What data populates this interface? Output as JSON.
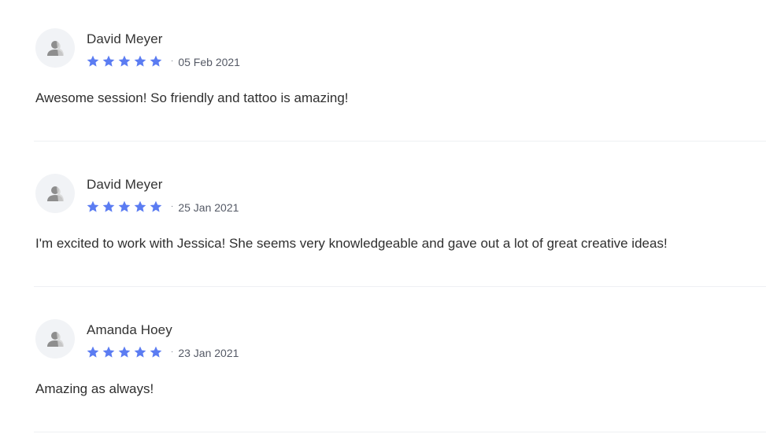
{
  "colors": {
    "star": "#5b7cf2",
    "avatar_bg": "#f1f3f6",
    "divider": "#eef0f3"
  },
  "icons": {
    "avatar": "user-icon",
    "rating": "star-icon"
  },
  "reviews": [
    {
      "name": "David Meyer",
      "rating": 5,
      "date": "05 Feb 2021",
      "separator": "·",
      "text": "Awesome session! So friendly and tattoo is amazing!"
    },
    {
      "name": "David Meyer",
      "rating": 5,
      "date": "25 Jan 2021",
      "separator": "·",
      "text": "I'm excited to work with Jessica! She seems very knowledgeable and gave out a lot of great creative ideas!"
    },
    {
      "name": "Amanda Hoey",
      "rating": 5,
      "date": "23 Jan 2021",
      "separator": "·",
      "text": "Amazing as always!"
    }
  ]
}
